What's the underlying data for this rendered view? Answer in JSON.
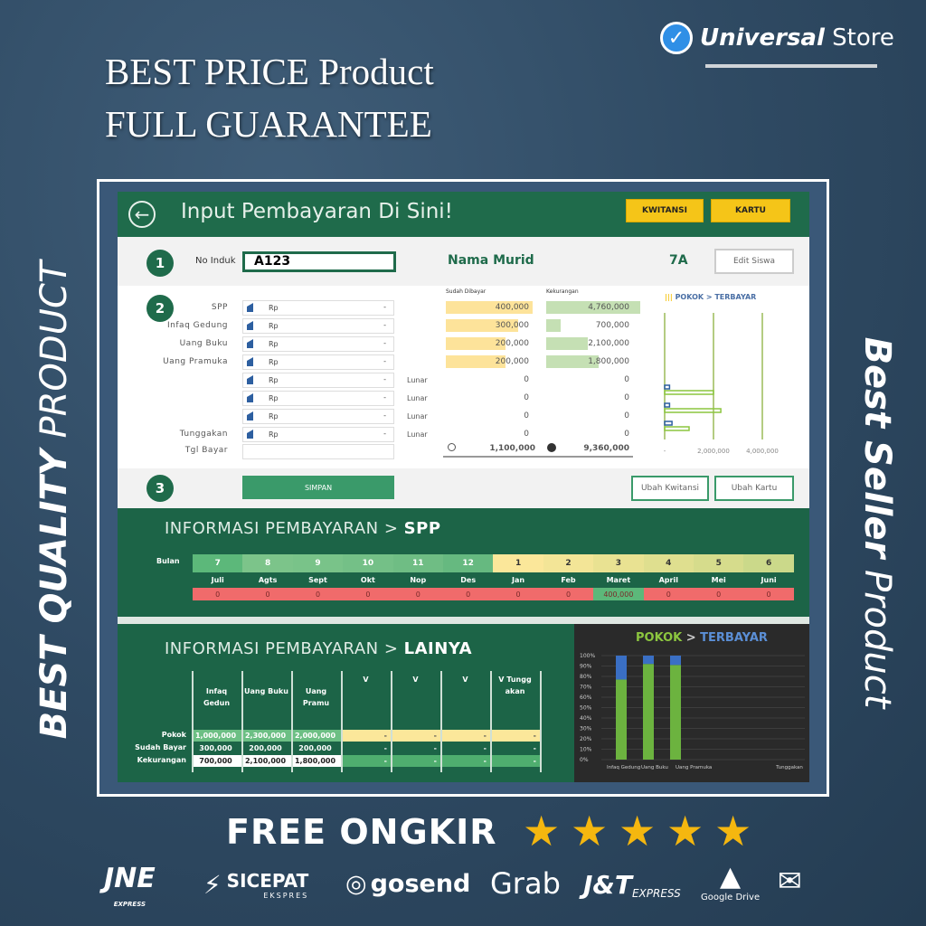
{
  "promo": {
    "line1": "BEST PRICE Product",
    "line2": "FULL GUARANTEE",
    "left_bold": "BEST QUALITY",
    "left_thin": "PRODUCT",
    "right_bold": "Best Seller",
    "right_thin": "Product",
    "free": "FREE ONGKIR",
    "stars": 5
  },
  "brand": {
    "bold": "Universal",
    "thin": "Store",
    "icon": "verified-check-icon"
  },
  "app": {
    "title": "Input Pembayaran Di Sini!",
    "buttons": {
      "kwitansi": "KWITANSI",
      "kartu": "KARTU",
      "edit_siswa": "Edit Siswa",
      "simpan": "SIMPAN",
      "ubah_kwitansi": "Ubah Kwitansi",
      "ubah_kartu": "Ubah Kartu"
    },
    "step1": {
      "num": "1",
      "label": "No Induk",
      "value": "A123",
      "nama": "Nama Murid",
      "kelas": "7A"
    },
    "step2": {
      "num": "2",
      "col_paid": "Sudah Dibayar",
      "col_due": "Kekurangan",
      "rows": [
        {
          "label": "SPP",
          "rp": "Rp",
          "dash": "-",
          "status": "",
          "paid": "400,000",
          "due": "4,760,000"
        },
        {
          "label": "Infaq Gedung",
          "rp": "Rp",
          "dash": "-",
          "status": "",
          "paid": "300,000",
          "due": "700,000"
        },
        {
          "label": "Uang Buku",
          "rp": "Rp",
          "dash": "-",
          "status": "",
          "paid": "200,000",
          "due": "2,100,000"
        },
        {
          "label": "Uang Pramuka",
          "rp": "Rp",
          "dash": "-",
          "status": "",
          "paid": "200,000",
          "due": "1,800,000"
        },
        {
          "label": "",
          "rp": "Rp",
          "dash": "-",
          "status": "Lunar",
          "paid": "0",
          "due": "0"
        },
        {
          "label": "",
          "rp": "Rp",
          "dash": "-",
          "status": "Lunar",
          "paid": "0",
          "due": "0"
        },
        {
          "label": "",
          "rp": "Rp",
          "dash": "-",
          "status": "Lunar",
          "paid": "0",
          "due": "0"
        },
        {
          "label": "Tunggakan",
          "rp": "Rp",
          "dash": "-",
          "status": "Lunar",
          "paid": "0",
          "due": "0"
        }
      ],
      "tgl_label": "Tgl Bayar",
      "total_paid": "1,100,000",
      "total_due": "9,360,000"
    },
    "step3": {
      "num": "3"
    },
    "spp": {
      "title": "INFORMASI PEMBAYARAN",
      "title_bold": "SPP",
      "sep": ">",
      "bulan": "Bulan",
      "nums": [
        "7",
        "8",
        "9",
        "10",
        "11",
        "12",
        "1",
        "2",
        "3",
        "4",
        "5",
        "6"
      ],
      "months": [
        "Juli",
        "Agts",
        "Sept",
        "Okt",
        "Nop",
        "Des",
        "Jan",
        "Feb",
        "Maret",
        "April",
        "Mei",
        "Juni"
      ],
      "values": [
        "0",
        "0",
        "0",
        "0",
        "0",
        "0",
        "0",
        "0",
        "400,000",
        "0",
        "0",
        "0"
      ]
    },
    "lainya": {
      "title": "INFORMASI PEMBAYARAN",
      "title_bold": "LAINYA",
      "sep": ">",
      "headers": [
        "Infaq Gedun",
        "Uang Buku",
        "Uang Pramu",
        "V",
        "V",
        "V",
        "V Tungg akan"
      ],
      "rows": [
        {
          "label": "Pokok",
          "values": [
            "1,000,000",
            "2,300,000",
            "2,000,000",
            "-",
            "-",
            "-",
            "-"
          ]
        },
        {
          "label": "Sudah Bayar",
          "values": [
            "300,000",
            "200,000",
            "200,000",
            "-",
            "-",
            "-",
            "-"
          ]
        },
        {
          "label": "Kekurangan",
          "values": [
            "700,000",
            "2,100,000",
            "1,800,000",
            "-",
            "-",
            "-",
            "-"
          ]
        }
      ]
    }
  },
  "chart_data": [
    {
      "type": "bar",
      "orientation": "horizontal",
      "title": "POKOK > TERBAYAR",
      "legend_marker": "|||",
      "xticks": [
        "-",
        "2,000,000",
        "4,000,000"
      ],
      "xlim": [
        0,
        5000000
      ],
      "series": [
        {
          "name": "TERBAYAR",
          "color": "#2d5fa0",
          "values": [
            200000,
            200000,
            300000
          ]
        },
        {
          "name": "POKOK",
          "color": "#8cc63f",
          "values": [
            2000000,
            2300000,
            1000000
          ]
        }
      ]
    },
    {
      "type": "bar",
      "stacked": true,
      "title": "POKOK > TERBAYAR",
      "title_parts": [
        "POKOK",
        ">",
        "TERBAYAR"
      ],
      "categories": [
        "Infaq Gedung",
        "Uang Buku",
        "Uang Pramuka",
        "",
        "",
        "",
        "Tunggakan"
      ],
      "yticks": [
        "0%",
        "10%",
        "20%",
        "30%",
        "40%",
        "50%",
        "60%",
        "70%",
        "80%",
        "90%",
        "100%"
      ],
      "ylim": [
        0,
        100
      ],
      "series": [
        {
          "color": "#6cb33f",
          "values": [
            77,
            92,
            91,
            0,
            0,
            0,
            0
          ]
        },
        {
          "color": "#3a6fc4",
          "values": [
            23,
            8,
            9,
            0,
            0,
            0,
            0
          ]
        }
      ]
    }
  ],
  "logos": [
    "JNE",
    "EXPRESS",
    "SICEPAT",
    "EKSPRES",
    "gosend",
    "Grab",
    "J&T",
    "EXPRESS",
    "Google Drive"
  ]
}
